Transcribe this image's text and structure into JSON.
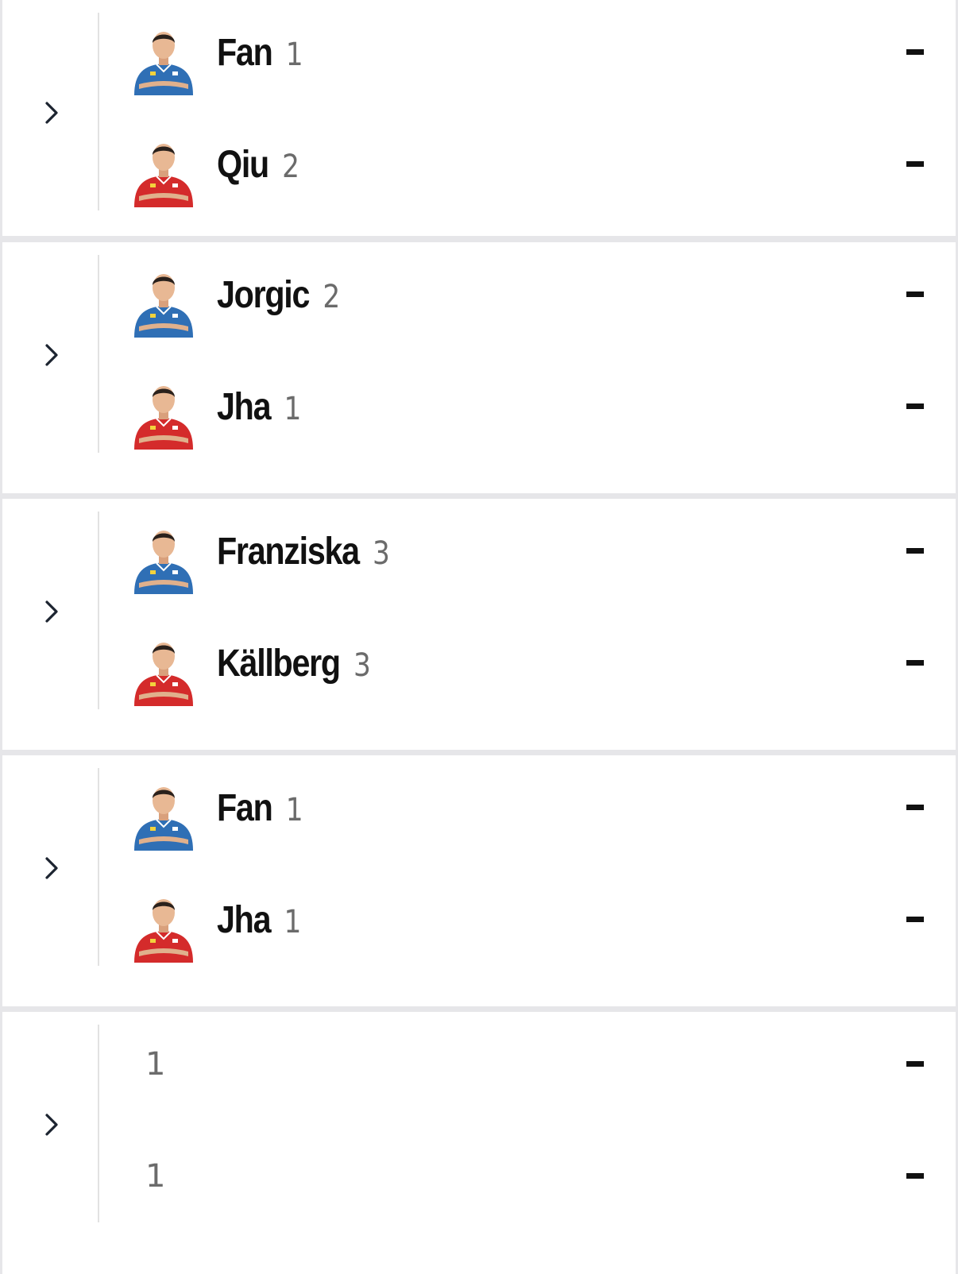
{
  "matches": [
    {
      "players": [
        {
          "name": "Fan",
          "seed": "1",
          "score": "-",
          "shirt": "#2f6fb5",
          "avatar": "player-photo-blue-shirt"
        },
        {
          "name": "Qiu",
          "seed": "2",
          "score": "-",
          "shirt": "#d42b2b",
          "avatar": "player-photo-red-shirt"
        }
      ]
    },
    {
      "players": [
        {
          "name": "Jorgic",
          "seed": "2",
          "score": "-",
          "shirt": "#2f6fb5",
          "avatar": "player-photo-blue-shirt"
        },
        {
          "name": "Jha",
          "seed": "1",
          "score": "-",
          "shirt": "#d42b2b",
          "avatar": "player-photo-red-shirt"
        }
      ]
    },
    {
      "players": [
        {
          "name": "Franziska",
          "seed": "3",
          "score": "-",
          "shirt": "#2f6fb5",
          "avatar": "player-photo-blue-shirt"
        },
        {
          "name": "Källberg",
          "seed": "3",
          "score": "-",
          "shirt": "#d42b2b",
          "avatar": "player-photo-red-shirt"
        }
      ]
    },
    {
      "players": [
        {
          "name": "Fan",
          "seed": "1",
          "score": "-",
          "shirt": "#2f6fb5",
          "avatar": "player-photo-blue-shirt"
        },
        {
          "name": "Jha",
          "seed": "1",
          "score": "-",
          "shirt": "#d42b2b",
          "avatar": "player-photo-red-shirt"
        }
      ]
    },
    {
      "players": [
        {
          "name": "",
          "seed": "1",
          "score": "-"
        },
        {
          "name": "",
          "seed": "1",
          "score": "-"
        }
      ]
    }
  ],
  "icons": {
    "expand": "chevron-right-icon"
  },
  "colors": {
    "background": "#e6e6e9",
    "card": "#ffffff",
    "name_text": "#111111",
    "seed_text": "#6b6b6b",
    "divider": "#e2e2e2"
  }
}
